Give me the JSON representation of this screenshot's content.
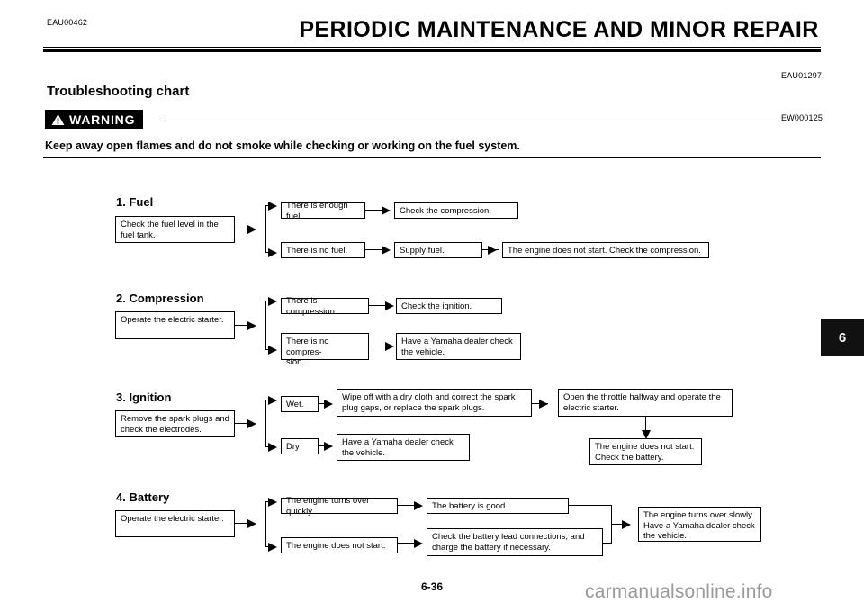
{
  "header": {
    "doc_code": "EAU00462",
    "title": "PERIODIC MAINTENANCE AND MINOR REPAIR"
  },
  "section": {
    "code": "EAU01297",
    "title": "Troubleshooting chart"
  },
  "warning": {
    "code": "EW000125",
    "label": "WARNING",
    "text": "Keep away open flames and do not smoke while checking or working on the fuel system."
  },
  "flow": {
    "fuel": {
      "title": "1. Fuel",
      "start": "Check the fuel level in the fuel tank.",
      "branch_top": "There is enough fuel.",
      "branch_bottom": "There is no fuel.",
      "top_result": "Check the compression.",
      "bottom_result": "Supply fuel.",
      "bottom_final": "The engine does not start. Check the compression."
    },
    "compression": {
      "title": "2. Compression",
      "start": "Operate the electric starter.",
      "branch_top": "There is compression.",
      "branch_bottom": "There is no compres-\nsion.",
      "top_result": "Check the ignition.",
      "bottom_result": "Have a Yamaha dealer check the vehicle."
    },
    "ignition": {
      "title": "3. Ignition",
      "start": "Remove the spark plugs and check the electrodes.",
      "branch_top": "Wet.",
      "branch_bottom": "Dry",
      "top_result": "Wipe off with a dry cloth and correct the spark plug gaps, or replace the spark plugs.",
      "top_result2": "Open the throttle halfway and operate the electric starter.",
      "top_result3": "The engine does not start. Check the battery.",
      "bottom_result": "Have a Yamaha dealer check the vehicle."
    },
    "battery": {
      "title": "4. Battery",
      "start": "Operate the electric starter.",
      "branch_top": "The engine turns over quickly.",
      "branch_bottom": "The engine does not start.",
      "top_result": "The battery is good.",
      "bottom_result": "Check the battery lead connections, and charge the battery if necessary.",
      "merged_result": "The engine turns over slowly. Have a Yamaha dealer check the vehicle."
    }
  },
  "footer": {
    "page_number": "6-36",
    "watermark": "carmanualsonline.info"
  },
  "side_tab": {
    "chapter": "6"
  }
}
